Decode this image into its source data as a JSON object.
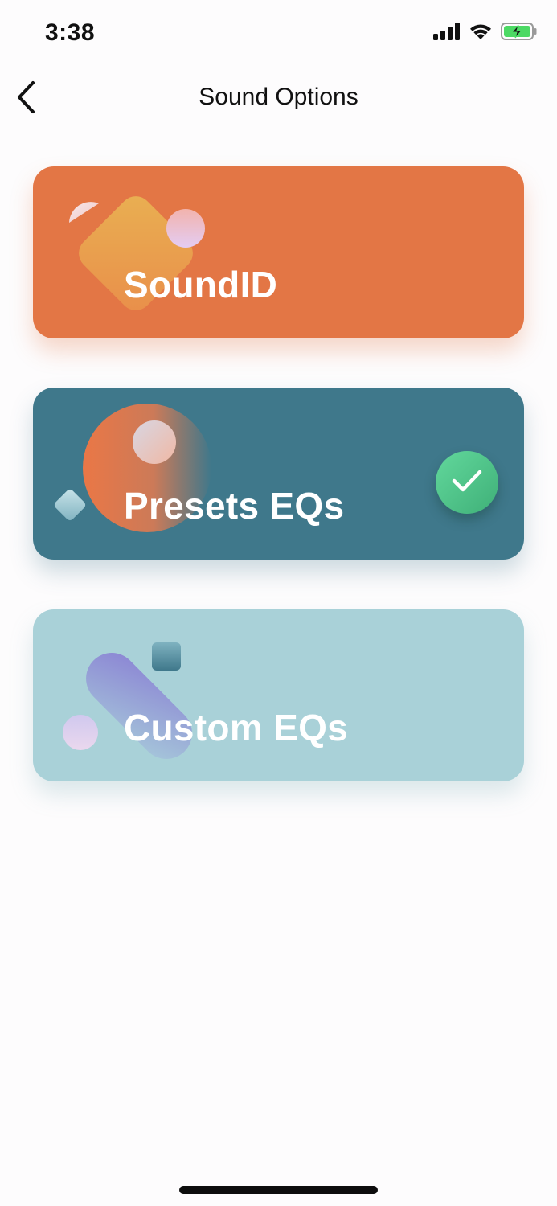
{
  "status_bar": {
    "time": "3:38"
  },
  "nav": {
    "title": "Sound Options"
  },
  "cards": [
    {
      "label": "SoundID",
      "selected": false,
      "color": "#e37645"
    },
    {
      "label": "Presets EQs",
      "selected": true,
      "color": "#3f788b"
    },
    {
      "label": "Custom EQs",
      "selected": false,
      "color": "#a9d1d8"
    }
  ],
  "icons": {
    "back": "chevron-left-icon",
    "signal": "cellular-signal-icon",
    "wifi": "wifi-icon",
    "battery": "battery-charging-icon",
    "check": "checkmark-icon"
  }
}
